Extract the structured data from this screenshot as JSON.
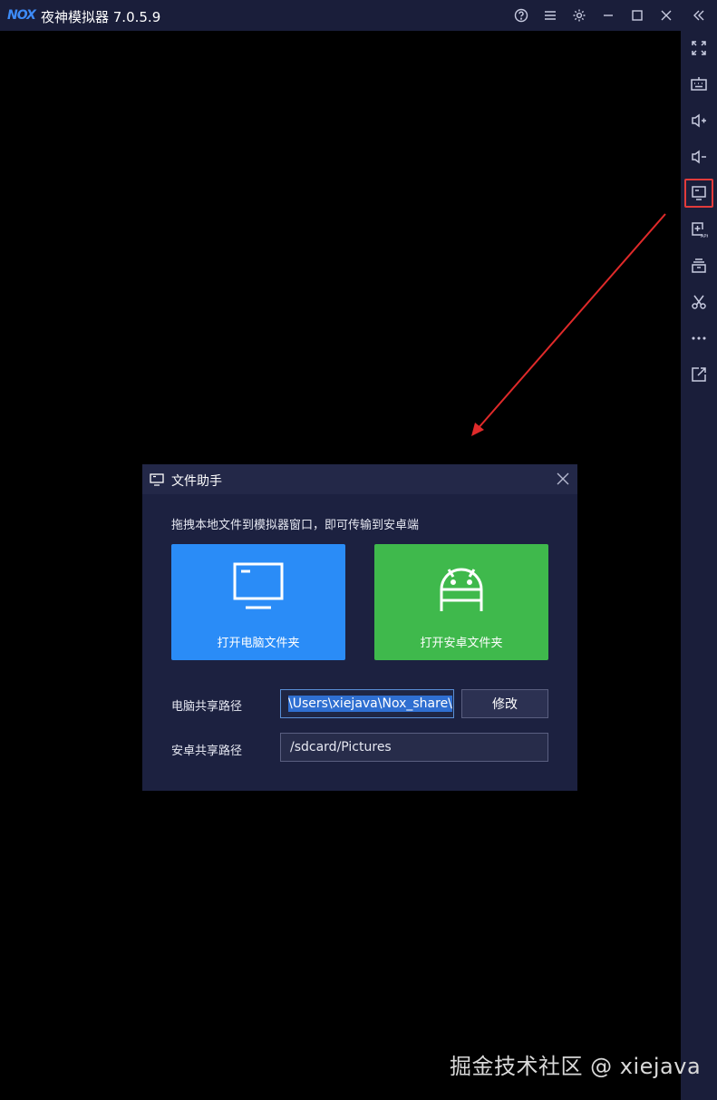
{
  "titlebar": {
    "logo": "NOX",
    "title": "夜神模拟器 7.0.5.9"
  },
  "dialog": {
    "title": "文件助手",
    "hint": "拖拽本地文件到模拟器窗口，即可传输到安卓端",
    "open_pc_folder_label": "打开电脑文件夹",
    "open_android_folder_label": "打开安卓文件夹",
    "pc_path_label": "电脑共享路径",
    "pc_path_value": "\\Users\\xiejava\\Nox_share\\",
    "modify_label": "修改",
    "android_path_label": "安卓共享路径",
    "android_path_value": "/sdcard/Pictures"
  },
  "watermark": "掘金技术社区 @ xiejava",
  "colors": {
    "titlebar_bg": "#1a1e3a",
    "pc_button": "#2a8cf7",
    "android_button": "#3fb94c",
    "highlight": "#e23b3b"
  }
}
